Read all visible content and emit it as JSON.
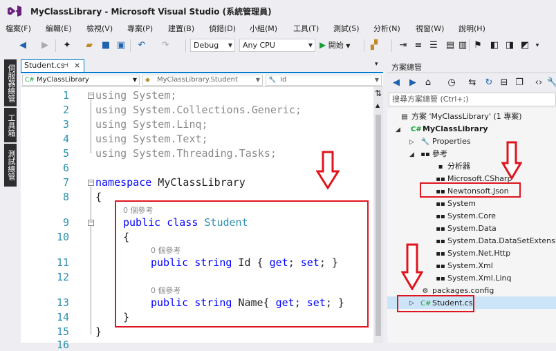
{
  "window": {
    "title": "MyClassLibrary - Microsoft Visual Studio (系統管理員)"
  },
  "menu": [
    "檔案(F)",
    "編輯(E)",
    "檢視(V)",
    "專案(P)",
    "建置(B)",
    "偵錯(D)",
    "小組(M)",
    "工具(T)",
    "測試(S)",
    "分析(N)",
    "視窗(W)",
    "說明(H)"
  ],
  "toolbar": {
    "config": "Debug",
    "platform": "Any CPU",
    "start_label": "開始"
  },
  "left_strip": [
    "伺服器總管",
    "工具箱",
    "測試總管"
  ],
  "editor": {
    "tab_label": "Student.cs",
    "nav": {
      "project": "MyClassLibrary",
      "type": "MyClassLibrary.Student",
      "member": "Id"
    },
    "line_numbers": [
      "1",
      "2",
      "3",
      "4",
      "5",
      "6",
      "7",
      "8",
      "9",
      "10",
      "11",
      "12",
      "13",
      "14",
      "15",
      "16"
    ],
    "lines": {
      "l1": "using System;",
      "l2": "using System.Collections.Generic;",
      "l3": "using System.Linq;",
      "l4": "using System.Text;",
      "l5": "using System.Threading.Tasks;",
      "l7_kw": "namespace",
      "l7_name": " MyClassLibrary",
      "l8": "{",
      "ref_class": "0 個參考",
      "l9_kw": "public class",
      "l9_type": " Student",
      "l10": "{",
      "ref_id": "0 個參考",
      "l11_kw1": "public",
      "l11_kw2": " string",
      "l11_id": " Id { ",
      "l11_get": "get",
      "l11_semi1": "; ",
      "l11_set": "set",
      "l11_end": "; }",
      "ref_name": "0 個參考",
      "l13_kw1": "public",
      "l13_kw2": " string",
      "l13_id": " Name{ ",
      "l13_get": "get",
      "l13_semi1": "; ",
      "l13_set": "set",
      "l13_end": "; }",
      "l14": "}",
      "l15": "}"
    }
  },
  "solution_explorer": {
    "title": "方案總管",
    "search_placeholder": "搜尋方案總管 (Ctrl+;)",
    "solution": "方案 'MyClassLibrary' (1 專案)",
    "project": "MyClassLibrary",
    "properties": "Properties",
    "references": "參考",
    "ref_items": [
      "分析器",
      "Microsoft.CSharp",
      "Newtonsoft.Json",
      "System",
      "System.Core",
      "System.Data",
      "System.Data.DataSetExtensions",
      "System.Net.Http",
      "System.Xml",
      "System.Xml.Linq"
    ],
    "packages_config": "packages.config",
    "student_cs": "Student.cs"
  },
  "colors": {
    "accent": "#007acc",
    "highlight": "#e0141e",
    "keyword": "#0000ff",
    "type": "#2b91af"
  }
}
